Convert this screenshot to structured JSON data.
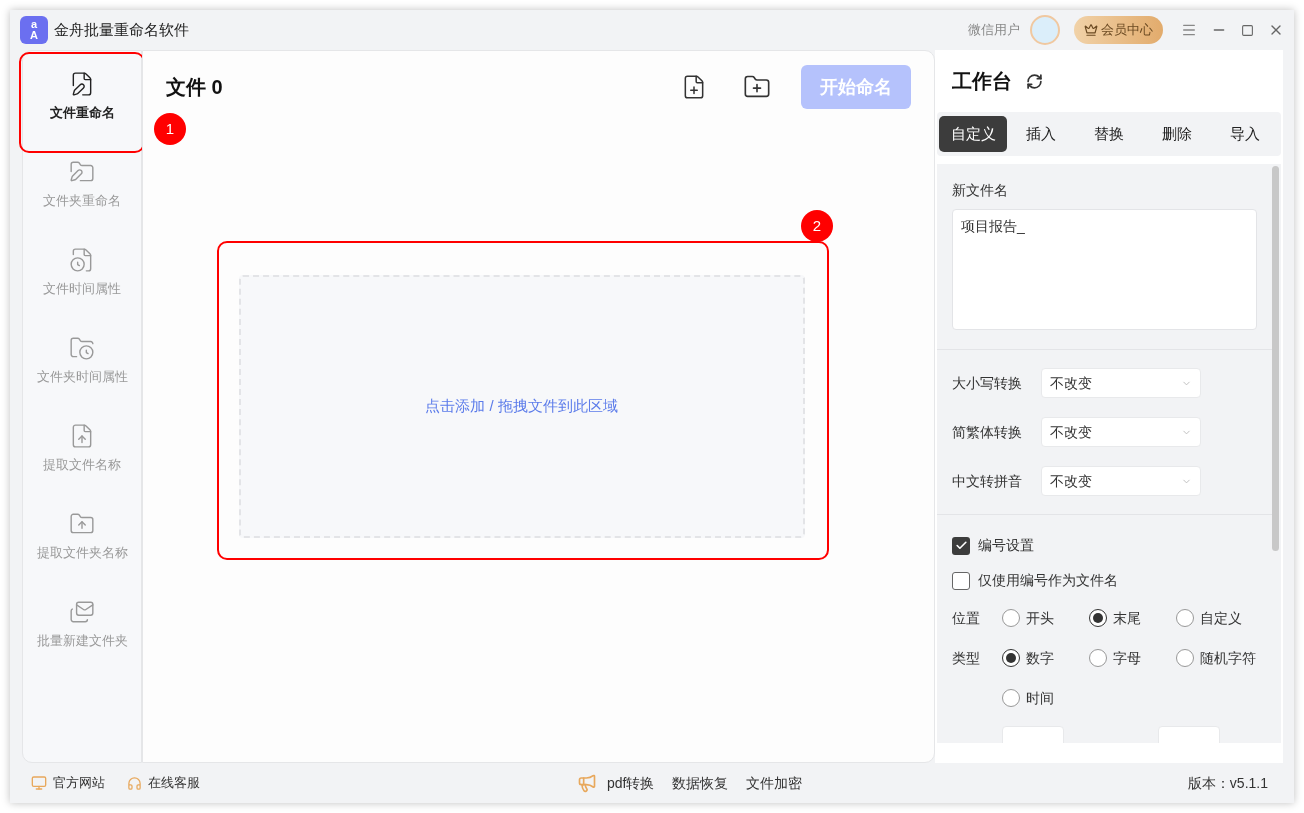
{
  "window": {
    "logo": {
      "top": "a",
      "bottom": "A"
    },
    "title": "金舟批量重命名软件",
    "user": "微信用户",
    "vip_button": "会员中心"
  },
  "sidebar": {
    "items": [
      {
        "label": "文件重命名",
        "selected": true
      },
      {
        "label": "文件夹重命名",
        "selected": false
      },
      {
        "label": "文件时间属性",
        "selected": false
      },
      {
        "label": "文件夹时间属性",
        "selected": false
      },
      {
        "label": "提取文件名称",
        "selected": false
      },
      {
        "label": "提取文件夹名称",
        "selected": false
      },
      {
        "label": "批量新建文件夹",
        "selected": false
      }
    ]
  },
  "main": {
    "title": "文件 0",
    "start_button": {
      "label": "开始命名",
      "disabled": true
    },
    "drop_zone": "点击添加 / 拖拽文件到此区域"
  },
  "annotations": [
    {
      "label": "1"
    },
    {
      "label": "2"
    }
  ],
  "workbench": {
    "title": "工作台",
    "tabs": [
      {
        "label": "自定义",
        "selected": true
      },
      {
        "label": "插入",
        "selected": false
      },
      {
        "label": "替换",
        "selected": false
      },
      {
        "label": "删除",
        "selected": false
      },
      {
        "label": "导入",
        "selected": false
      }
    ],
    "new_name": {
      "label": "新文件名",
      "value": "项目报告_"
    },
    "dropdowns": [
      {
        "label": "大小写转换",
        "value": "不改变"
      },
      {
        "label": "简繁体转换",
        "value": "不改变"
      },
      {
        "label": "中文转拼音",
        "value": "不改变"
      }
    ],
    "checkboxes": [
      {
        "label": "编号设置",
        "checked": true
      },
      {
        "label": "仅使用编号作为文件名",
        "checked": false
      }
    ],
    "radio_groups": [
      {
        "label": "位置",
        "options": [
          {
            "label": "开头",
            "selected": false
          },
          {
            "label": "末尾",
            "selected": true
          },
          {
            "label": "自定义",
            "selected": false
          }
        ]
      },
      {
        "label": "类型",
        "options": [
          {
            "label": "数字",
            "selected": true
          },
          {
            "label": "字母",
            "selected": false
          },
          {
            "label": "随机字符",
            "selected": false
          },
          {
            "label": "时间",
            "selected": false
          }
        ]
      }
    ]
  },
  "footer": {
    "left": [
      "官方网站",
      "在线客服"
    ],
    "center": [
      "pdf转换",
      "数据恢复",
      "文件加密"
    ],
    "version": "版本：v5.1.1"
  }
}
